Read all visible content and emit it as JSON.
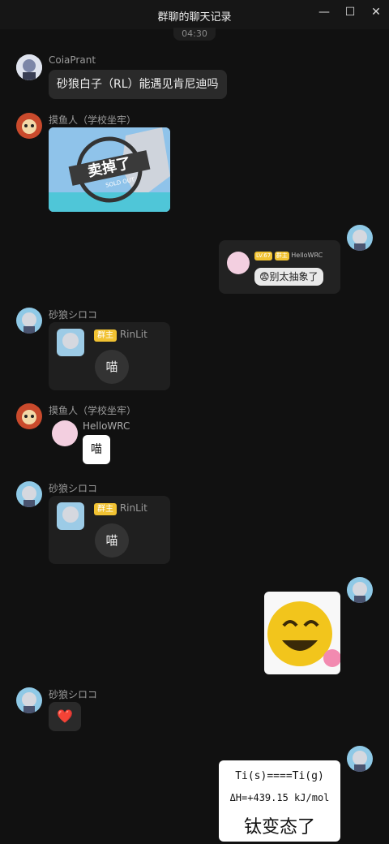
{
  "window": {
    "title": "群聊的聊天记录"
  },
  "controls": {
    "minimize": "—",
    "maximize": "☐",
    "close": "✕"
  },
  "time_divider": "04:30",
  "colors": {
    "background": "#111111",
    "bubble": "#2a2a2a",
    "tag": "#f1c232"
  },
  "messages": [
    {
      "sender": "CoiaPrant",
      "text": "砂狼白子（RL）能遇见肯尼迪吗"
    },
    {
      "sender": "摸鱼人（学校坐牢）",
      "image_text": "卖掉了",
      "stamp_text": "SOLD OUT"
    },
    {
      "self": true,
      "quote_level": "LV.67",
      "quote_tag": "群主",
      "quote_user": "HelloWRC",
      "quote_text": "😨别太抽象了"
    },
    {
      "sender": "砂狼シロコ",
      "card_tag": "群主",
      "card_user": "RinLit",
      "card_text": "喵"
    },
    {
      "sender": "摸鱼人（学校坐牢）",
      "quote_user": "HelloWRC",
      "quote_text": "喵"
    },
    {
      "sender": "砂狼シロコ",
      "card_tag": "群主",
      "card_user": "RinLit",
      "card_text": "喵"
    },
    {
      "self": true,
      "sticker": "laughing-emoji"
    },
    {
      "sender": "砂狼シロコ",
      "text": "❤️"
    },
    {
      "self": true,
      "line1": "Ti(s)====Ti(g)",
      "line2": "ΔH=+439.15 kJ/mol",
      "line3": "钛变态了"
    }
  ]
}
